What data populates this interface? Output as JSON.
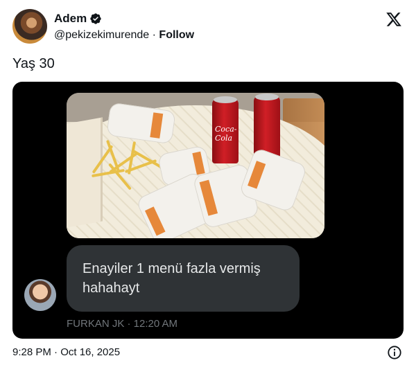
{
  "user": {
    "display_name": "Adem",
    "handle": "@pekizekimurende",
    "separator": " · ",
    "follow_label": "Follow"
  },
  "tweet": {
    "text": "Yaş 30",
    "timestamp": "9:28 PM · Oct 16, 2025"
  },
  "media": {
    "dm_message": "Enayiler 1 menü fazla vermiş hahahayt",
    "dm_sender_meta": "FURKAN JK · 12:20 AM",
    "can_label": "Coca-Cola"
  },
  "icons": {
    "verified": "verified-badge-icon",
    "platform": "x-logo-icon",
    "info": "info-icon"
  },
  "colors": {
    "text_primary": "#0f1419",
    "media_bg": "#000000",
    "bubble_bg": "#2f3336",
    "meta_gray": "#71767b"
  }
}
